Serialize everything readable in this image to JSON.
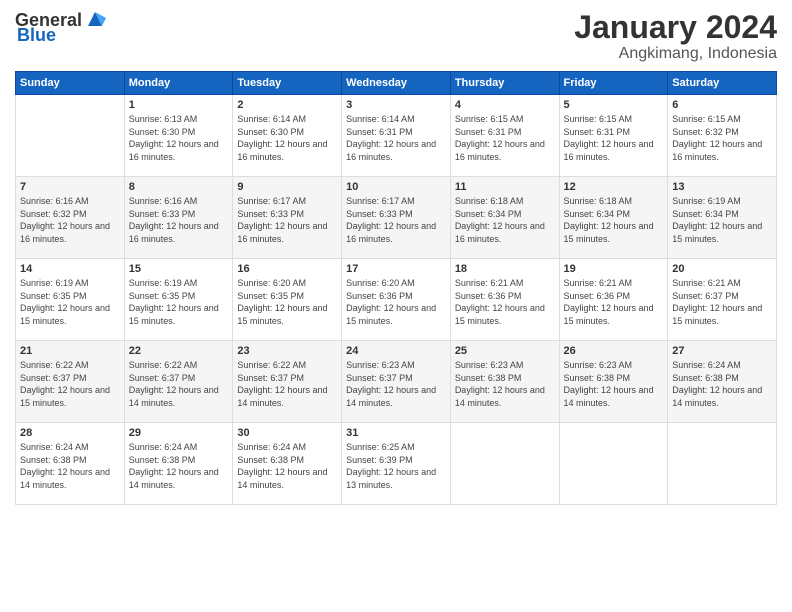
{
  "header": {
    "logo_general": "General",
    "logo_blue": "Blue",
    "month_year": "January 2024",
    "location": "Angkimang, Indonesia"
  },
  "days_of_week": [
    "Sunday",
    "Monday",
    "Tuesday",
    "Wednesday",
    "Thursday",
    "Friday",
    "Saturday"
  ],
  "weeks": [
    [
      {
        "day": "",
        "sunrise": "",
        "sunset": "",
        "daylight": ""
      },
      {
        "day": "1",
        "sunrise": "Sunrise: 6:13 AM",
        "sunset": "Sunset: 6:30 PM",
        "daylight": "Daylight: 12 hours and 16 minutes."
      },
      {
        "day": "2",
        "sunrise": "Sunrise: 6:14 AM",
        "sunset": "Sunset: 6:30 PM",
        "daylight": "Daylight: 12 hours and 16 minutes."
      },
      {
        "day": "3",
        "sunrise": "Sunrise: 6:14 AM",
        "sunset": "Sunset: 6:31 PM",
        "daylight": "Daylight: 12 hours and 16 minutes."
      },
      {
        "day": "4",
        "sunrise": "Sunrise: 6:15 AM",
        "sunset": "Sunset: 6:31 PM",
        "daylight": "Daylight: 12 hours and 16 minutes."
      },
      {
        "day": "5",
        "sunrise": "Sunrise: 6:15 AM",
        "sunset": "Sunset: 6:31 PM",
        "daylight": "Daylight: 12 hours and 16 minutes."
      },
      {
        "day": "6",
        "sunrise": "Sunrise: 6:15 AM",
        "sunset": "Sunset: 6:32 PM",
        "daylight": "Daylight: 12 hours and 16 minutes."
      }
    ],
    [
      {
        "day": "7",
        "sunrise": "Sunrise: 6:16 AM",
        "sunset": "Sunset: 6:32 PM",
        "daylight": "Daylight: 12 hours and 16 minutes."
      },
      {
        "day": "8",
        "sunrise": "Sunrise: 6:16 AM",
        "sunset": "Sunset: 6:33 PM",
        "daylight": "Daylight: 12 hours and 16 minutes."
      },
      {
        "day": "9",
        "sunrise": "Sunrise: 6:17 AM",
        "sunset": "Sunset: 6:33 PM",
        "daylight": "Daylight: 12 hours and 16 minutes."
      },
      {
        "day": "10",
        "sunrise": "Sunrise: 6:17 AM",
        "sunset": "Sunset: 6:33 PM",
        "daylight": "Daylight: 12 hours and 16 minutes."
      },
      {
        "day": "11",
        "sunrise": "Sunrise: 6:18 AM",
        "sunset": "Sunset: 6:34 PM",
        "daylight": "Daylight: 12 hours and 16 minutes."
      },
      {
        "day": "12",
        "sunrise": "Sunrise: 6:18 AM",
        "sunset": "Sunset: 6:34 PM",
        "daylight": "Daylight: 12 hours and 15 minutes."
      },
      {
        "day": "13",
        "sunrise": "Sunrise: 6:19 AM",
        "sunset": "Sunset: 6:34 PM",
        "daylight": "Daylight: 12 hours and 15 minutes."
      }
    ],
    [
      {
        "day": "14",
        "sunrise": "Sunrise: 6:19 AM",
        "sunset": "Sunset: 6:35 PM",
        "daylight": "Daylight: 12 hours and 15 minutes."
      },
      {
        "day": "15",
        "sunrise": "Sunrise: 6:19 AM",
        "sunset": "Sunset: 6:35 PM",
        "daylight": "Daylight: 12 hours and 15 minutes."
      },
      {
        "day": "16",
        "sunrise": "Sunrise: 6:20 AM",
        "sunset": "Sunset: 6:35 PM",
        "daylight": "Daylight: 12 hours and 15 minutes."
      },
      {
        "day": "17",
        "sunrise": "Sunrise: 6:20 AM",
        "sunset": "Sunset: 6:36 PM",
        "daylight": "Daylight: 12 hours and 15 minutes."
      },
      {
        "day": "18",
        "sunrise": "Sunrise: 6:21 AM",
        "sunset": "Sunset: 6:36 PM",
        "daylight": "Daylight: 12 hours and 15 minutes."
      },
      {
        "day": "19",
        "sunrise": "Sunrise: 6:21 AM",
        "sunset": "Sunset: 6:36 PM",
        "daylight": "Daylight: 12 hours and 15 minutes."
      },
      {
        "day": "20",
        "sunrise": "Sunrise: 6:21 AM",
        "sunset": "Sunset: 6:37 PM",
        "daylight": "Daylight: 12 hours and 15 minutes."
      }
    ],
    [
      {
        "day": "21",
        "sunrise": "Sunrise: 6:22 AM",
        "sunset": "Sunset: 6:37 PM",
        "daylight": "Daylight: 12 hours and 15 minutes."
      },
      {
        "day": "22",
        "sunrise": "Sunrise: 6:22 AM",
        "sunset": "Sunset: 6:37 PM",
        "daylight": "Daylight: 12 hours and 14 minutes."
      },
      {
        "day": "23",
        "sunrise": "Sunrise: 6:22 AM",
        "sunset": "Sunset: 6:37 PM",
        "daylight": "Daylight: 12 hours and 14 minutes."
      },
      {
        "day": "24",
        "sunrise": "Sunrise: 6:23 AM",
        "sunset": "Sunset: 6:37 PM",
        "daylight": "Daylight: 12 hours and 14 minutes."
      },
      {
        "day": "25",
        "sunrise": "Sunrise: 6:23 AM",
        "sunset": "Sunset: 6:38 PM",
        "daylight": "Daylight: 12 hours and 14 minutes."
      },
      {
        "day": "26",
        "sunrise": "Sunrise: 6:23 AM",
        "sunset": "Sunset: 6:38 PM",
        "daylight": "Daylight: 12 hours and 14 minutes."
      },
      {
        "day": "27",
        "sunrise": "Sunrise: 6:24 AM",
        "sunset": "Sunset: 6:38 PM",
        "daylight": "Daylight: 12 hours and 14 minutes."
      }
    ],
    [
      {
        "day": "28",
        "sunrise": "Sunrise: 6:24 AM",
        "sunset": "Sunset: 6:38 PM",
        "daylight": "Daylight: 12 hours and 14 minutes."
      },
      {
        "day": "29",
        "sunrise": "Sunrise: 6:24 AM",
        "sunset": "Sunset: 6:38 PM",
        "daylight": "Daylight: 12 hours and 14 minutes."
      },
      {
        "day": "30",
        "sunrise": "Sunrise: 6:24 AM",
        "sunset": "Sunset: 6:38 PM",
        "daylight": "Daylight: 12 hours and 14 minutes."
      },
      {
        "day": "31",
        "sunrise": "Sunrise: 6:25 AM",
        "sunset": "Sunset: 6:39 PM",
        "daylight": "Daylight: 12 hours and 13 minutes."
      },
      {
        "day": "",
        "sunrise": "",
        "sunset": "",
        "daylight": ""
      },
      {
        "day": "",
        "sunrise": "",
        "sunset": "",
        "daylight": ""
      },
      {
        "day": "",
        "sunrise": "",
        "sunset": "",
        "daylight": ""
      }
    ]
  ]
}
